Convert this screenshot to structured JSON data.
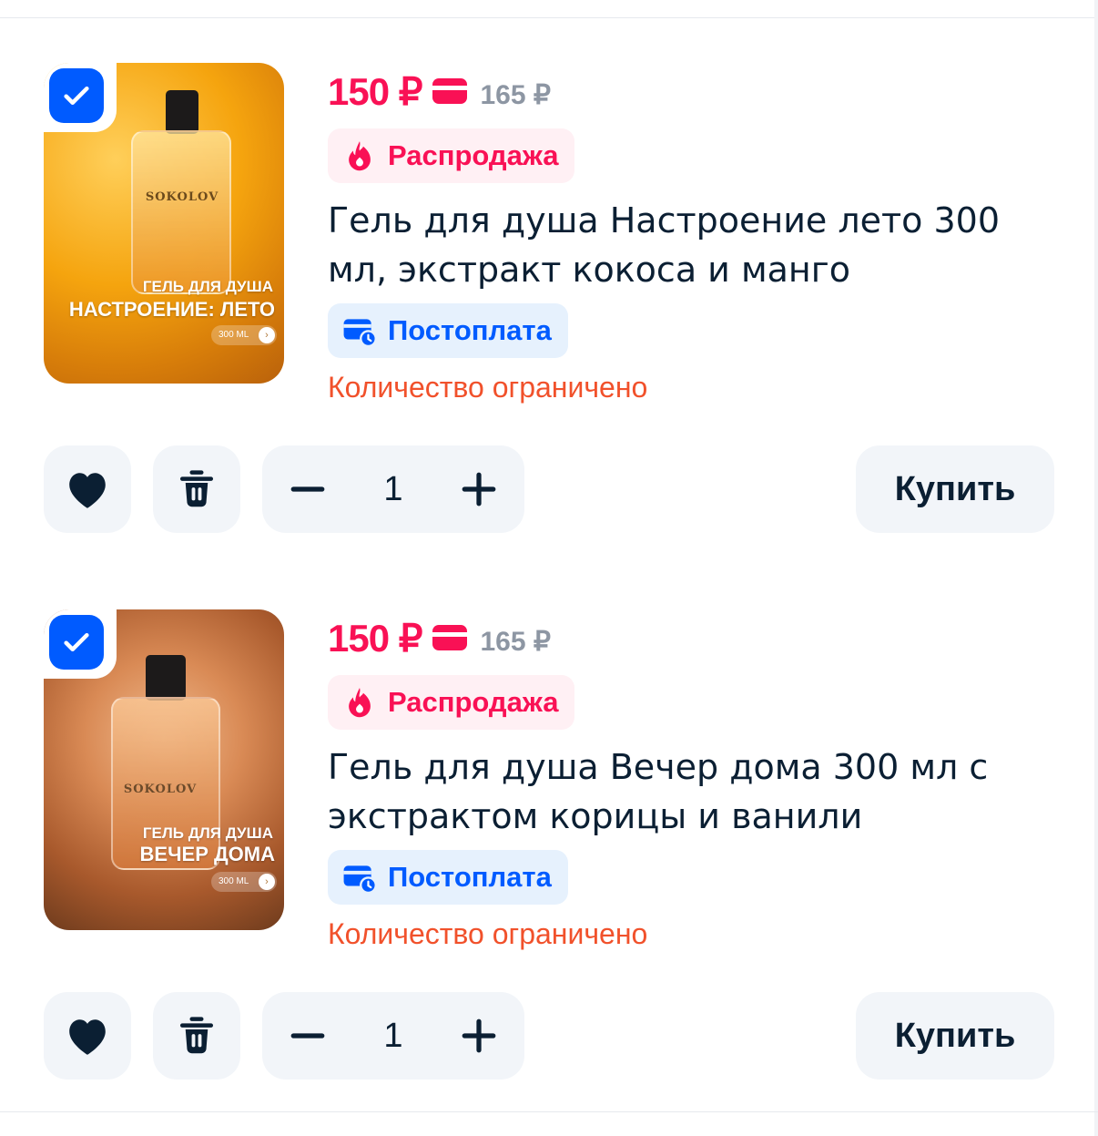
{
  "items": [
    {
      "price": "150 ₽",
      "old_price": "165 ₽",
      "sale_badge": "Распродажа",
      "title": "Гель для душа Настроение лето 300 мл, экстракт кокоса и манго",
      "payment_badge": "Постоплата",
      "stock_note": "Количество ограничено",
      "quantity": "1",
      "buy_label": "Купить",
      "checked": true,
      "image": {
        "brand": "SOKOLOV",
        "caption_small": "ГЕЛЬ ДЛЯ ДУША",
        "caption_big": "НАСТРОЕНИЕ: ЛЕТО",
        "volume": "300 ML"
      }
    },
    {
      "price": "150 ₽",
      "old_price": "165 ₽",
      "sale_badge": "Распродажа",
      "title": "Гель для душа Вечер дома 300 мл с экстрактом корицы и ванили",
      "payment_badge": "Постоплата",
      "stock_note": "Количество ограничено",
      "quantity": "1",
      "buy_label": "Купить",
      "checked": true,
      "image": {
        "brand": "SOKOLOV",
        "caption_small": "ГЕЛЬ ДЛЯ ДУША",
        "caption_big": "ВЕЧЕР ДОМА",
        "volume": "300 ML"
      }
    }
  ],
  "icons": {
    "checkbox": "checkmark-icon",
    "card": "card-icon",
    "sale": "flame-icon",
    "postpay": "card-clock-icon",
    "favorite": "heart-icon",
    "delete": "trash-icon",
    "minus": "minus-icon",
    "plus": "plus-icon"
  },
  "colors": {
    "price": "#f91155",
    "old_price": "#8d96a3",
    "accent_blue": "#005bff",
    "limited": "#f1512b",
    "button_bg": "#f2f5f9"
  }
}
